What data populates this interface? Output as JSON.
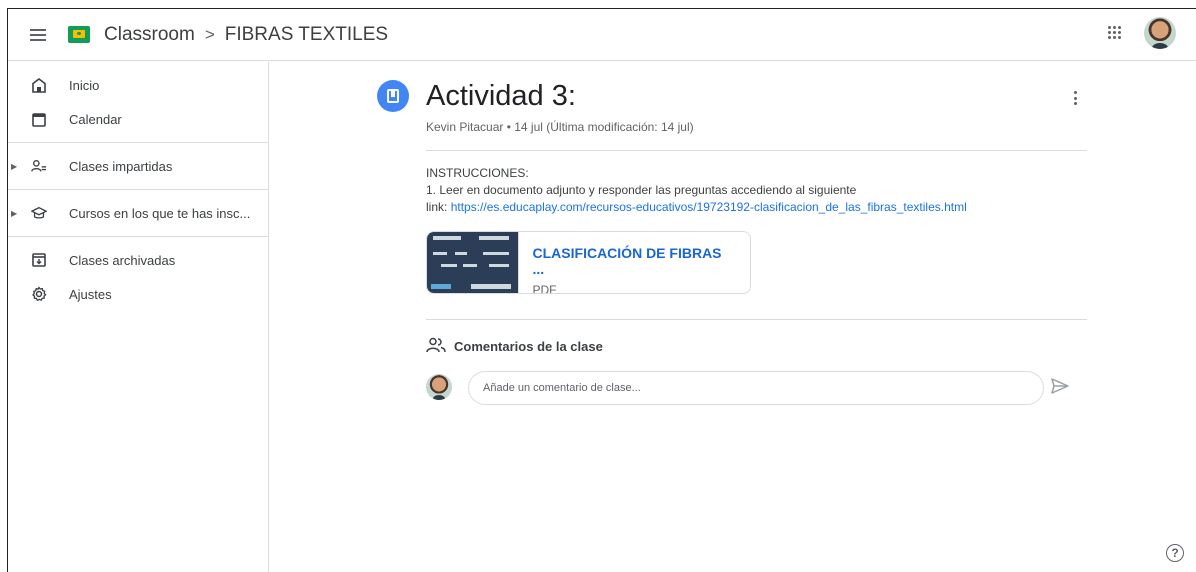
{
  "header": {
    "app_name": "Classroom",
    "separator": ">",
    "course_name": "FIBRAS TEXTILES"
  },
  "sidebar": {
    "items": [
      {
        "label": "Inicio",
        "icon": "home-icon"
      },
      {
        "label": "Calendar",
        "icon": "calendar-icon"
      },
      {
        "label": "Clases impartidas",
        "icon": "teacher-icon"
      },
      {
        "label": "Cursos en los que te has insc...",
        "icon": "school-icon"
      },
      {
        "label": "Clases archivadas",
        "icon": "archive-icon"
      },
      {
        "label": "Ajustes",
        "icon": "settings-icon"
      }
    ]
  },
  "post": {
    "title": "Actividad 3:",
    "meta": "Kevin Pitacuar • 14 jul (Última modificación: 14 jul)",
    "instructions_heading": "INSTRUCCIONES:",
    "instructions_line": "1. Leer en documento adjunto y responder las preguntas accediendo al siguiente",
    "link_prefix": "link: ",
    "link_url": "https://es.educaplay.com/recursos-educativos/19723192-clasificacion_de_las_fibras_textiles.html",
    "attachment": {
      "title": "CLASIFICACIÓN DE FIBRAS ...",
      "type": "PDF"
    }
  },
  "comments": {
    "heading": "Comentarios de la clase",
    "placeholder": "Añade un comentario de clase..."
  },
  "colors": {
    "accent": "#1a73e8",
    "post_icon": "#4285f4",
    "logo_green": "#0f9d58",
    "logo_yellow": "#fbbc04"
  }
}
